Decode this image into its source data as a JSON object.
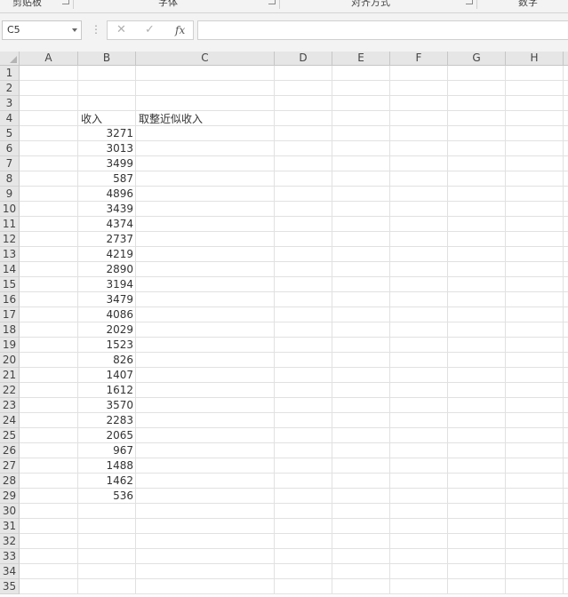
{
  "ribbon": {
    "groups": [
      {
        "label": "剪贴板"
      },
      {
        "label": "字体"
      },
      {
        "label": "对齐方式"
      },
      {
        "label": "数字"
      }
    ]
  },
  "formula_bar": {
    "name_box": "C5",
    "cancel_icon": "cancel-icon",
    "enter_icon": "check-icon",
    "fx_label": "fx",
    "formula": ""
  },
  "columns": [
    "A",
    "B",
    "C",
    "D",
    "E",
    "F",
    "G",
    "H"
  ],
  "rows": [
    "1",
    "2",
    "3",
    "4",
    "5",
    "6",
    "7",
    "8",
    "9",
    "10",
    "11",
    "12",
    "13",
    "14",
    "15",
    "16",
    "17",
    "18",
    "19",
    "20",
    "21",
    "22",
    "23",
    "24",
    "25",
    "26",
    "27",
    "28",
    "29",
    "30",
    "31",
    "32",
    "33",
    "34",
    "35"
  ],
  "sheet": {
    "header_b": "收入",
    "header_c": "取整近似收入",
    "income": [
      "3271",
      "3013",
      "3499",
      "587",
      "4896",
      "3439",
      "4374",
      "2737",
      "4219",
      "2890",
      "3194",
      "3479",
      "4086",
      "2029",
      "1523",
      "826",
      "1407",
      "1612",
      "3570",
      "2283",
      "2065",
      "967",
      "1488",
      "1462",
      "536"
    ]
  },
  "colors": {
    "header_bg": "#e6e6e6",
    "gridline": "#e1e1e1",
    "toolbar_bg": "#f3f3f3"
  }
}
